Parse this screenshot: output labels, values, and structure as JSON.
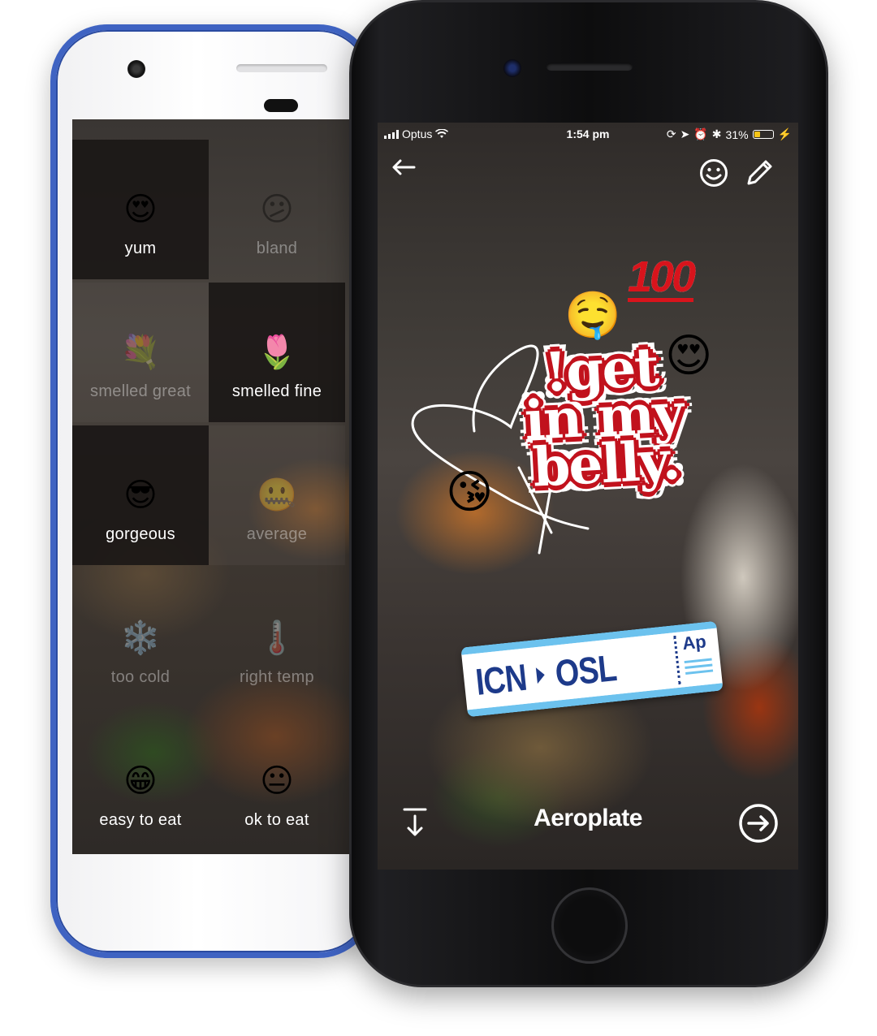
{
  "back_phone": {
    "options": [
      {
        "label": "yum",
        "icon": "heart-eyes-emoji",
        "glyph": "😍",
        "selected": true,
        "faded": false
      },
      {
        "label": "bland",
        "icon": "confused-face-emoji",
        "glyph": "😕",
        "selected": false,
        "faded": true
      },
      {
        "label": "smelled great",
        "icon": "bouquet-emoji",
        "glyph": "💐",
        "selected": false,
        "faded": true
      },
      {
        "label": "smelled fine",
        "icon": "tulip-emoji",
        "glyph": "🌷",
        "selected": true,
        "faded": false
      },
      {
        "label": "gorgeous",
        "icon": "sunglasses-face-emoji",
        "glyph": "😎",
        "selected": true,
        "faded": false
      },
      {
        "label": "average",
        "icon": "zipper-mouth-emoji",
        "glyph": "🤐",
        "selected": false,
        "faded": true
      },
      {
        "label": "too cold",
        "icon": "snowflake-emoji",
        "glyph": "❄️",
        "selected": false,
        "faded": true
      },
      {
        "label": "right temp",
        "icon": "thermometer-check-emoji",
        "glyph": "🌡️",
        "selected": false,
        "faded": true
      },
      {
        "label": "easy to eat",
        "icon": "grinning-face-emoji",
        "glyph": "😁",
        "selected": false,
        "faded": false
      },
      {
        "label": "ok to eat",
        "icon": "neutral-face-emoji",
        "glyph": "😐",
        "selected": false,
        "faded": false
      }
    ]
  },
  "front_phone": {
    "status_bar": {
      "carrier": "Optus",
      "time": "1:54 pm",
      "battery": "31%",
      "battery_level": 0.31
    },
    "stickers": {
      "hundred": "100",
      "headline": "!get in my belly.",
      "drool_emoji": "🤤",
      "heart_eyes_emoji": "😍",
      "kiss_emoji": "😘",
      "ticket": {
        "from": "ICN",
        "to": "OSL",
        "logo": "Ap"
      }
    },
    "caption": "Aeroplate",
    "icons": [
      "back-arrow-icon",
      "emoji-sticker-icon",
      "pencil-icon",
      "download-icon",
      "next-arrow-icon"
    ],
    "colors": {
      "accent_red": "#c1121d",
      "ticket_blue": "#1d3a8a",
      "ticket_sky": "#6cc2ee"
    }
  }
}
